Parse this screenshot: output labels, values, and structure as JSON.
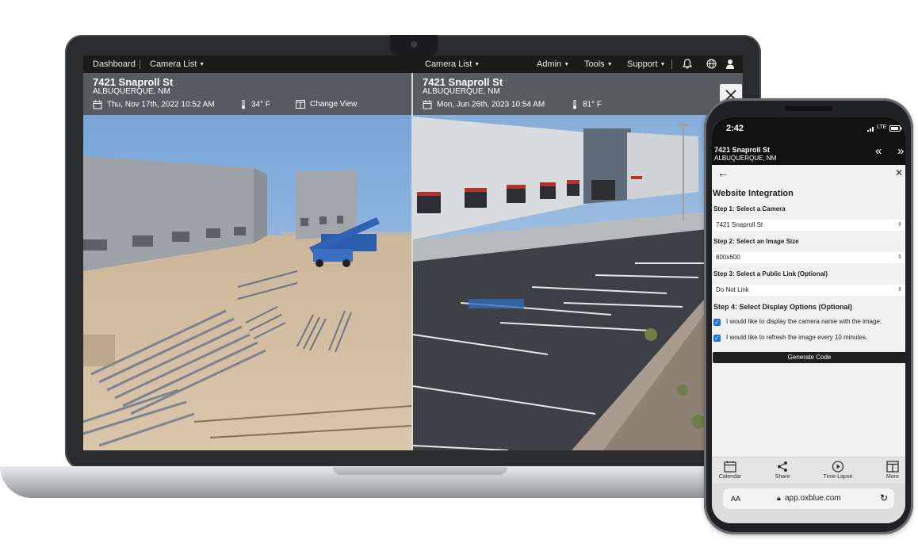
{
  "app": {
    "nav": {
      "left": [
        "Dashboard",
        "Camera List"
      ],
      "center": "Camera List",
      "right": [
        "Admin",
        "Tools",
        "Support"
      ],
      "icons": [
        "bell-icon",
        "globe-icon",
        "user-icon"
      ]
    },
    "left_camera": {
      "address": "7421 Snaproll St",
      "city": "ALBUQUERQUE, NM",
      "datetime": "Thu, Nov 17th, 2022 10:52 AM",
      "temperature": "34° F",
      "change_view": "Change View"
    },
    "right_camera": {
      "address": "7421 Snaproll St",
      "city": "ALBUQUERQUE, NM",
      "datetime": "Mon, Jun 26th, 2023 10:54 AM",
      "temperature": "81° F"
    }
  },
  "phone": {
    "time": "2:42",
    "signal": "LTE",
    "header": {
      "address": "7421 Snaproll St",
      "city": "ALBUQUERQUE, NM"
    },
    "panel": {
      "title": "Website Integration",
      "step1_label": "Step 1: Select a Camera",
      "step1_value": "7421 Snaproll St",
      "step2_label": "Step 2: Select an Image Size",
      "step2_value": "800x600",
      "step3_label": "Step 3: Select a Public Link (Optional)",
      "step3_value": "Do Not Link",
      "step4_label": "Step 4: Select Display Options (Optional)",
      "option1": "I would like to display the camera name with the image.",
      "option2": "I would like to refresh the image every 10 minutes.",
      "generate_button": "Generate Code"
    },
    "tabs": [
      "Calendar",
      "Share",
      "Time-Lapse",
      "More"
    ],
    "browser": {
      "text_size": "AA",
      "url": "app.oxblue.com"
    }
  },
  "colors": {
    "checkbox": "#1a73e8",
    "button": "#1f1f1f",
    "info_overlay": "#555555"
  }
}
